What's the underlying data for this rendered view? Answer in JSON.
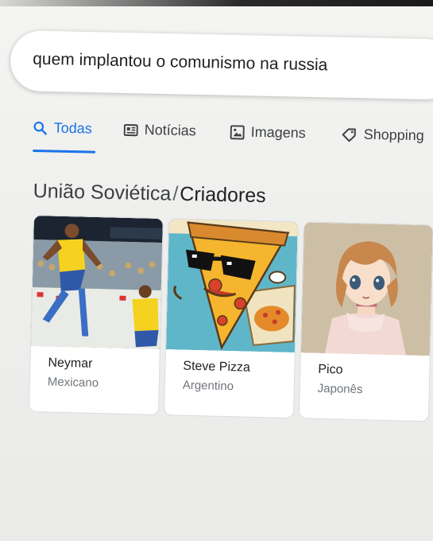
{
  "search": {
    "query": "quem implantou o comunismo na russia"
  },
  "tabs": [
    {
      "label": "Todas",
      "icon": "search-icon",
      "active": true
    },
    {
      "label": "Notícias",
      "icon": "news-icon",
      "active": false
    },
    {
      "label": "Imagens",
      "icon": "image-icon",
      "active": false
    },
    {
      "label": "Shopping",
      "icon": "tag-icon",
      "active": false
    }
  ],
  "knowledge": {
    "entity": "União Soviética",
    "separator": "/",
    "attribute": "Criadores"
  },
  "cards": [
    {
      "name": "Neymar",
      "subtitle": "Mexicano",
      "image": "soccer-player-photo"
    },
    {
      "name": "Steve Pizza",
      "subtitle": "Argentino",
      "image": "cartoon-pizza-with-sunglasses"
    },
    {
      "name": "Pico",
      "subtitle": "Japonês",
      "image": "anime-character-drawing"
    }
  ],
  "colors": {
    "accent": "#1a73e8",
    "text": "#202124",
    "muted": "#70757a"
  }
}
